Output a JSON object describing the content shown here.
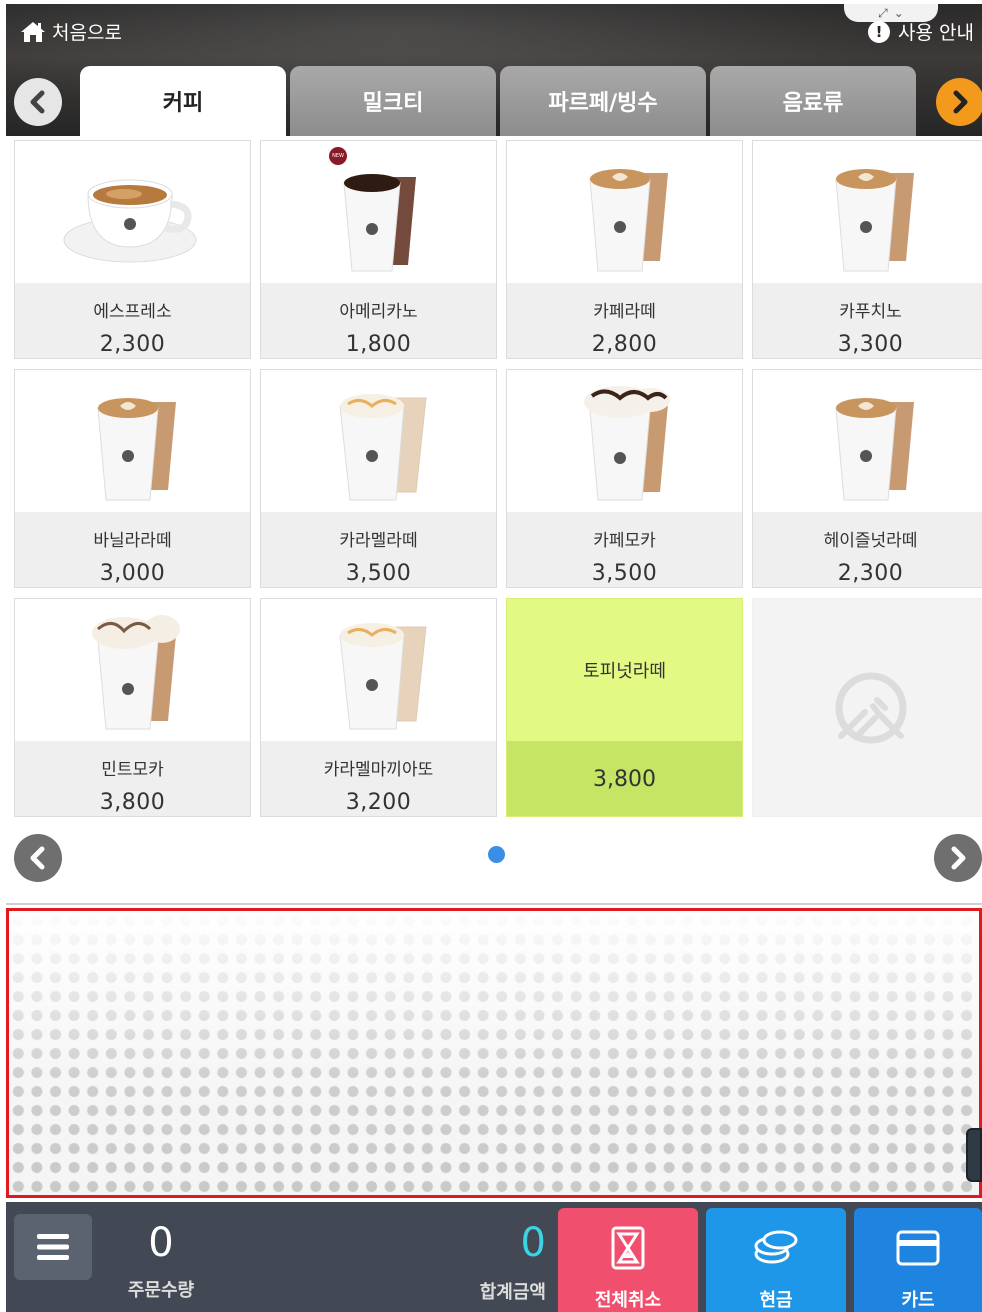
{
  "header": {
    "home_label": "처음으로",
    "guide_label": "사용 안내"
  },
  "tabs": [
    {
      "label": "커피"
    },
    {
      "label": "밀크티"
    },
    {
      "label": "파르페/빙수"
    },
    {
      "label": "음료류"
    }
  ],
  "products": [
    {
      "name": "에스프레소",
      "price": "2,300"
    },
    {
      "name": "아메리카노",
      "price": "1,800"
    },
    {
      "name": "카페라떼",
      "price": "2,800"
    },
    {
      "name": "카푸치노",
      "price": "3,300"
    },
    {
      "name": "바닐라라떼",
      "price": "3,000"
    },
    {
      "name": "카라멜라떼",
      "price": "3,500"
    },
    {
      "name": "카페모카",
      "price": "3,500"
    },
    {
      "name": "헤이즐넛라떼",
      "price": "2,300"
    },
    {
      "name": "민트모카",
      "price": "3,800"
    },
    {
      "name": "카라멜마끼아또",
      "price": "3,200"
    },
    {
      "name": "토피넛라떼",
      "price": "3,800"
    }
  ],
  "bottom_bar": {
    "qty_value": "0",
    "qty_label": "주문수량",
    "total_value": "0",
    "total_label": "합계금액",
    "cancel_all_label": "전체취소",
    "cash_label": "현금",
    "card_label": "카드"
  },
  "colors": {
    "accent_orange": "#f39a1d",
    "featured_bg": "#e2fa83",
    "cancel_btn": "#f0506e",
    "cash_btn": "#1f97e8",
    "card_btn": "#1f84e0",
    "cart_border": "#e0191e",
    "total_value": "#3cd3e2"
  }
}
